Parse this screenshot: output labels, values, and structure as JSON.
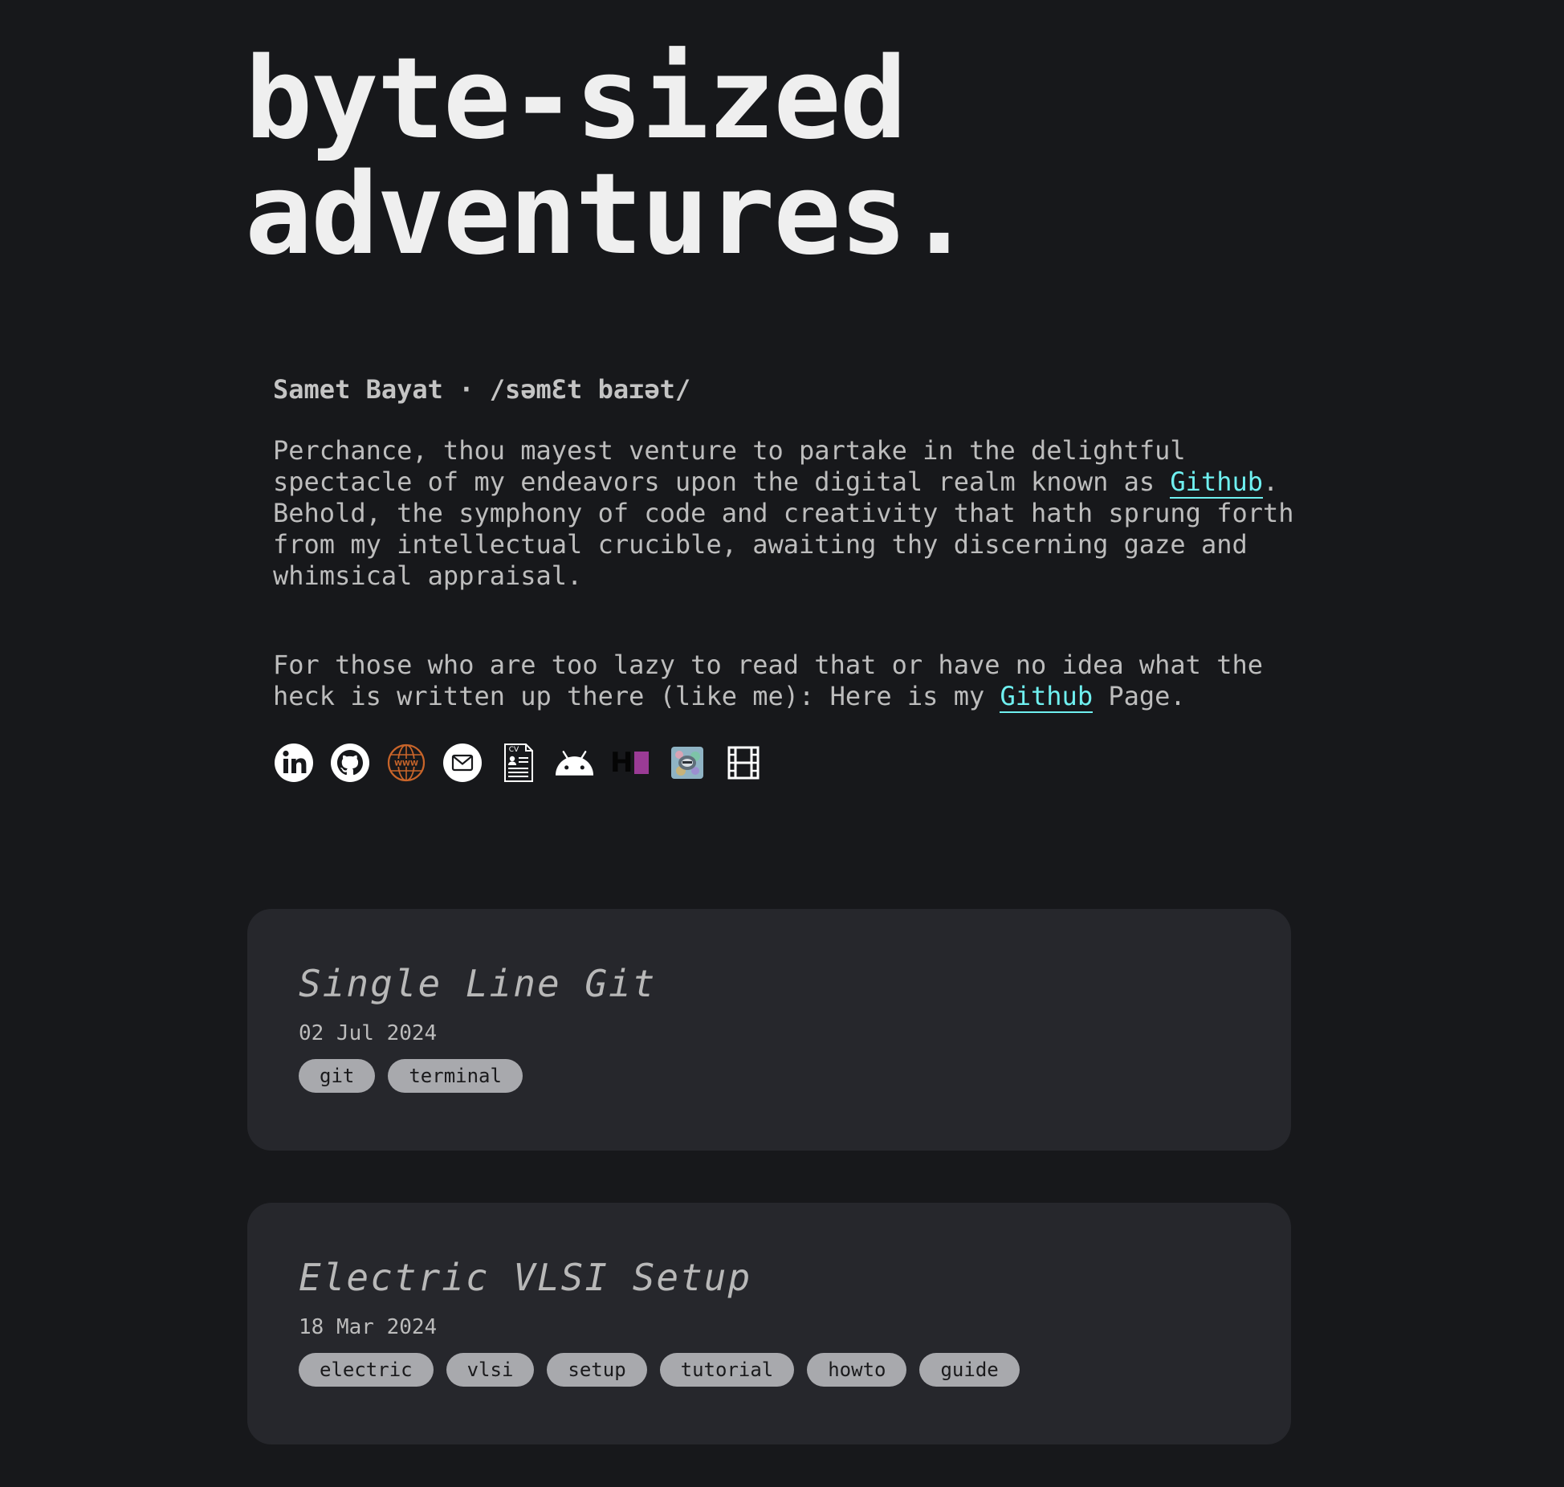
{
  "hero": {
    "line1": "byte-sized",
    "line2": "adventures."
  },
  "intro": {
    "name_line": "Samet Bayat · /səmƐt baɪət/",
    "p1_before": "Perchance, thou mayest venture to partake in the delightful spectacle of my endeavors upon the digital realm known as ",
    "p1_link": "Github",
    "p1_after": ". Behold, the symphony of code and creativity that hath sprung forth from my intellectual crucible, awaiting thy discerning gaze and whimsical appraisal.",
    "p2_before": "For those who are too lazy to read that or have no idea what the heck is written up there (like me): Here is my ",
    "p2_link": "Github",
    "p2_after": " Page."
  },
  "social_icons": [
    "linkedin-icon",
    "github-icon",
    "website-icon",
    "email-icon",
    "cv-icon",
    "android-icon",
    "hackmd-icon",
    "avatar-icon",
    "film-icon"
  ],
  "cv_icon_label": "CV",
  "hackmd_letter": "H",
  "posts": [
    {
      "title": "Single Line Git",
      "date": "02 Jul 2024",
      "tags": [
        "git",
        "terminal"
      ]
    },
    {
      "title": "Electric VLSI Setup",
      "date": "18 Mar 2024",
      "tags": [
        "electric",
        "vlsi",
        "setup",
        "tutorial",
        "howto",
        "guide"
      ]
    }
  ],
  "colors": {
    "background": "#17181b",
    "card": "#26272c",
    "link": "#6ff0f0",
    "tag_bg": "#a8a9ad",
    "hackmd_accent": "#9a3b95"
  }
}
